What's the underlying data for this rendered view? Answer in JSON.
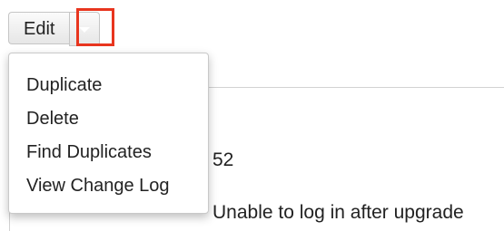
{
  "actions": {
    "edit_label": "Edit",
    "menu_items": [
      {
        "label": "Duplicate"
      },
      {
        "label": "Delete"
      },
      {
        "label": "Find Duplicates"
      },
      {
        "label": "View Change Log"
      }
    ]
  },
  "record": {
    "number": "52",
    "subject": "Unable to log in after upgrade"
  },
  "colors": {
    "highlight": "#e8351e",
    "caret": "#ffffff"
  },
  "icons": {
    "caret": "chevron-down-icon"
  }
}
